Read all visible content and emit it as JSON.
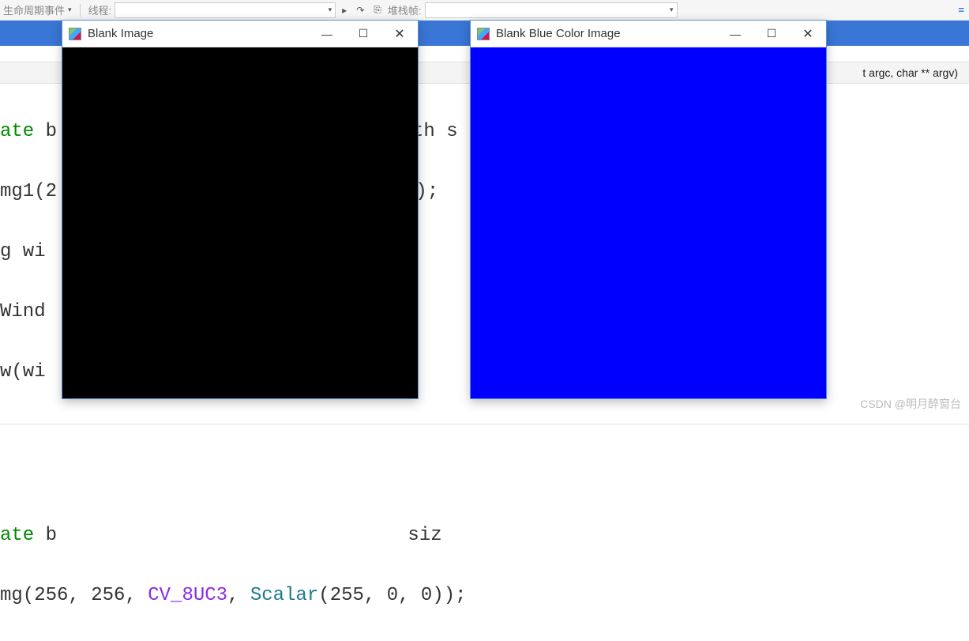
{
  "toolbar": {
    "left_label": "生命周期事件",
    "thread_label": "线程:",
    "arrow_icon": "chevron-down",
    "stack_label": "堆栈帧:",
    "equal_icon": "="
  },
  "file_nav": {
    "signature_fragment": "t argc, char ** argv)"
  },
  "editor": {
    "line1_a": "ate ",
    "line1_b": "b",
    "line1_c": "th s",
    "line2_a": "mg1(2",
    "line2_b": "));",
    "line3_a": "g wi",
    "line4_a": "Wind",
    "line5_a": "w(wi",
    "line7_a": "ate ",
    "line7_b": "b",
    "line7_c": " siz",
    "line8_a": "mg(256, 256, ",
    "line8_cv": "CV_8UC3",
    "line8_b": ", ",
    "line8_scalar": "Scalar",
    "line8_c": "(255, 0, 0));"
  },
  "windows": {
    "w1": {
      "title": "Blank Image",
      "content_color": "#000000"
    },
    "w2": {
      "title": "Blank Blue Color Image",
      "content_color": "#0000ff"
    }
  },
  "window_controls": {
    "minimize": "—",
    "maximize": "☐",
    "close": "✕"
  },
  "watermark": "CSDN @明月醉窗台"
}
